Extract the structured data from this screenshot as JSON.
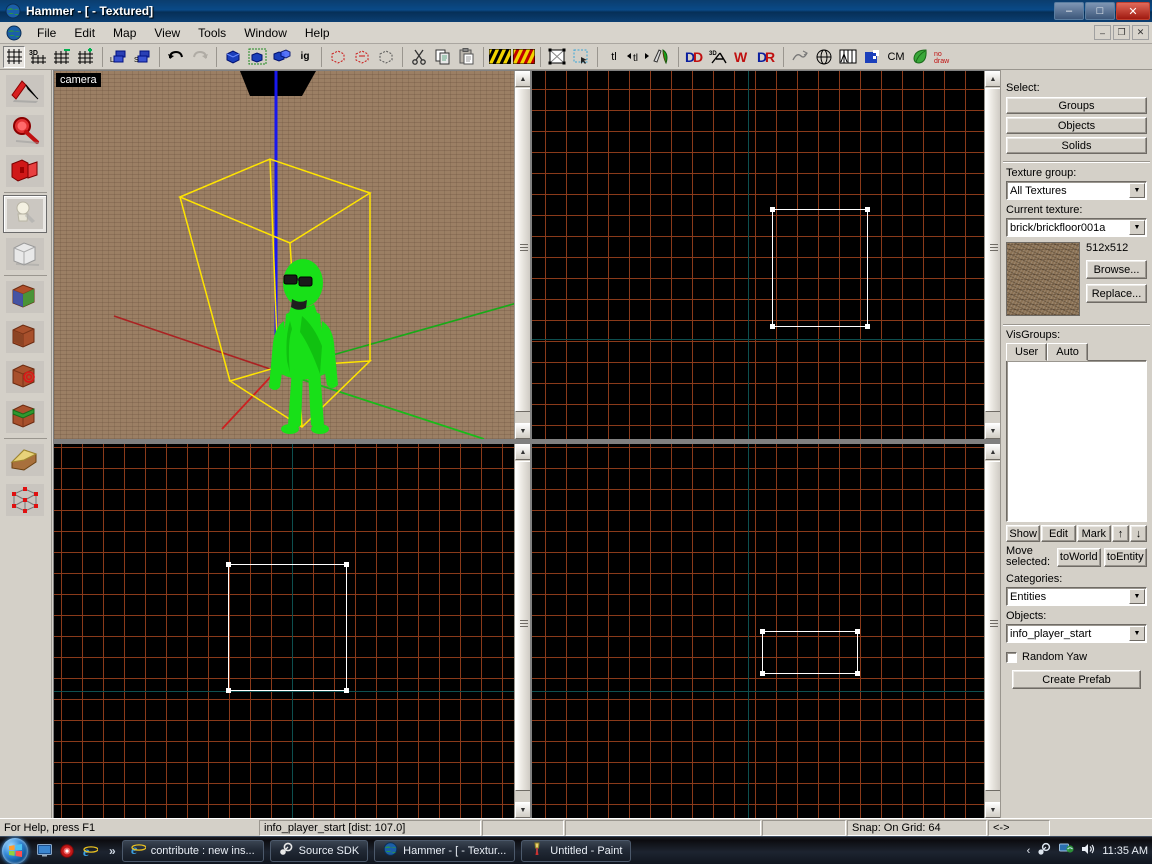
{
  "window": {
    "title": "Hammer - [ - Textured]",
    "icon": "hammer-globe-icon",
    "minimize": "–",
    "maximize": "□",
    "close": "✕"
  },
  "mdi": {
    "minimize": "–",
    "restore": "❐",
    "close": "✕"
  },
  "menu": {
    "items": [
      {
        "label": "File"
      },
      {
        "label": "Edit"
      },
      {
        "label": "Map"
      },
      {
        "label": "View"
      },
      {
        "label": "Tools"
      },
      {
        "label": "Window"
      },
      {
        "label": "Help"
      }
    ]
  },
  "toolbar": {
    "groups": [
      {
        "buttons": [
          {
            "name": "toggle-2d-grid",
            "glyph": "grid",
            "pressed": true
          },
          {
            "name": "toggle-3d-grid",
            "glyph": "grid3d",
            "pressed": false
          },
          {
            "name": "grid-smaller",
            "glyph": "grid-minus",
            "pressed": false
          },
          {
            "name": "grid-larger",
            "glyph": "grid-plus",
            "pressed": false
          }
        ]
      },
      {
        "buttons": [
          {
            "name": "load-pointfile",
            "glyph": "group-l",
            "pressed": false
          },
          {
            "name": "save-selection",
            "glyph": "group-s",
            "pressed": false
          }
        ]
      },
      {
        "buttons": [
          {
            "name": "undo",
            "glyph": "undo",
            "pressed": false
          },
          {
            "name": "redo",
            "glyph": "redo",
            "pressed": false
          }
        ]
      },
      {
        "buttons": [
          {
            "name": "carve",
            "glyph": "solid-blue",
            "pressed": false
          },
          {
            "name": "group",
            "glyph": "group-dashed",
            "pressed": false
          },
          {
            "name": "ungroup",
            "glyph": "ungroup",
            "pressed": false
          },
          {
            "name": "ignore-groups",
            "glyph": "ig",
            "pressed": false
          }
        ]
      },
      {
        "buttons": [
          {
            "name": "hide-selected",
            "glyph": "hide-red",
            "pressed": false
          },
          {
            "name": "hide-unselected",
            "glyph": "hide-red2",
            "pressed": false
          },
          {
            "name": "show-all",
            "glyph": "hide-gray",
            "pressed": false
          }
        ]
      },
      {
        "buttons": [
          {
            "name": "cut",
            "glyph": "scissors",
            "pressed": false
          },
          {
            "name": "copy",
            "glyph": "copy",
            "pressed": false
          },
          {
            "name": "paste",
            "glyph": "paste",
            "pressed": false
          }
        ]
      },
      {
        "buttons": [
          {
            "name": "toggle-cordon",
            "glyph": "hazard-yellow",
            "pressed": false
          },
          {
            "name": "edit-cordon",
            "glyph": "hazard-red",
            "pressed": false
          }
        ]
      },
      {
        "buttons": [
          {
            "name": "toggle-selection-box",
            "glyph": "selbox",
            "pressed": false
          },
          {
            "name": "toggle-auto-select",
            "glyph": "selbox-dashed",
            "pressed": false
          }
        ]
      },
      {
        "buttons": [
          {
            "name": "texture-lock",
            "glyph": "tl",
            "pressed": false
          },
          {
            "name": "texture-scaling-lock",
            "glyph": "tl-scale",
            "pressed": false
          },
          {
            "name": "toggle-texture-apply",
            "glyph": "texapply",
            "pressed": false
          }
        ]
      },
      {
        "buttons": [
          {
            "name": "show-displacement",
            "glyph": "dd",
            "pressed": false
          },
          {
            "name": "show-model-detail",
            "glyph": "3dangle",
            "pressed": false
          },
          {
            "name": "toggle-world-geometry",
            "glyph": "w-red",
            "pressed": false
          },
          {
            "name": "toggle-radius-culling",
            "glyph": "dr",
            "pressed": false
          }
        ]
      },
      {
        "buttons": [
          {
            "name": "run-map",
            "glyph": "runmap",
            "pressed": false
          },
          {
            "name": "toggle-sphere",
            "glyph": "sphere",
            "pressed": false
          },
          {
            "name": "texture-browser",
            "glyph": "texbrowse",
            "pressed": false
          },
          {
            "name": "toggle-cordon-tool",
            "glyph": "checker",
            "pressed": false
          },
          {
            "name": "center-on-map",
            "glyph": "cm",
            "pressed": false
          },
          {
            "name": "toggle-hint",
            "glyph": "leaf",
            "pressed": false
          },
          {
            "name": "nodraw-texture",
            "glyph": "nodraw",
            "pressed": false
          }
        ]
      }
    ],
    "cm_label": "CM",
    "ig_label": "ig",
    "tl_label": "tl",
    "nodraw_label": "no\ndraw"
  },
  "tools": {
    "items": [
      {
        "name": "selection-tool",
        "label": "Selection Tool",
        "selected": false
      },
      {
        "name": "magnify-tool",
        "label": "Magnify",
        "selected": false
      },
      {
        "name": "camera-tool",
        "label": "Camera",
        "selected": false
      },
      {
        "name": "entity-tool",
        "label": "Entity Tool",
        "selected": true
      },
      {
        "name": "block-tool",
        "label": "Block Tool",
        "selected": false
      },
      {
        "name": "texture-application-tool",
        "label": "Texture Application",
        "selected": false
      },
      {
        "name": "apply-decals-tool",
        "label": "Apply Decals",
        "selected": false
      },
      {
        "name": "apply-overlays-tool",
        "label": "Apply Overlays",
        "selected": false
      },
      {
        "name": "clipping-tool",
        "label": "Clipping Tool",
        "selected": false
      },
      {
        "name": "vertex-tool",
        "label": "Vertex Tool",
        "selected": false
      }
    ]
  },
  "viewports": {
    "camera_label": "camera",
    "view_3d": {
      "name": "3d-textured-viewport",
      "label": "camera"
    },
    "top": {
      "name": "top-2d-viewport"
    },
    "front": {
      "name": "front-2d-viewport"
    },
    "side": {
      "name": "side-2d-viewport"
    }
  },
  "right_panel": {
    "select_label": "Select:",
    "select_buttons": [
      {
        "label": "Groups",
        "name": "select-groups-button"
      },
      {
        "label": "Objects",
        "name": "select-objects-button"
      },
      {
        "label": "Solids",
        "name": "select-solids-button"
      }
    ],
    "texture_group_label": "Texture group:",
    "texture_group_value": "All Textures",
    "current_texture_label": "Current texture:",
    "current_texture_value": "brick/brickfloor001a",
    "texture_size": "512x512",
    "browse_label": "Browse...",
    "replace_label": "Replace...",
    "visgroups_label": "VisGroups:",
    "tabs": [
      {
        "label": "User",
        "active": true
      },
      {
        "label": "Auto",
        "active": false
      }
    ],
    "visgroup_items": [],
    "show_label": "Show",
    "edit_label": "Edit",
    "mark_label": "Mark",
    "up_arrow": "↑",
    "down_arrow": "↓",
    "move_selected_label": "Move\nselected:",
    "move_line1": "Move",
    "move_line2": "selected:",
    "to_world_label": "toWorld",
    "to_entity_label": "toEntity",
    "categories_label": "Categories:",
    "categories_value": "Entities",
    "objects_label": "Objects:",
    "objects_value": "info_player_start",
    "random_yaw_label": "Random Yaw",
    "random_yaw_checked": false,
    "create_prefab_label": "Create Prefab"
  },
  "status_bar": {
    "help": "For Help, press F1",
    "selection": "info_player_start   [dist: 107.0]",
    "cell3": "",
    "cell4": "",
    "cell5": "",
    "snap": "Snap: On Grid: 64",
    "zoom": "<->"
  },
  "taskbar": {
    "start_label": "",
    "quick_launch": [
      {
        "name": "show-desktop-icon",
        "glyph": "desktop"
      },
      {
        "name": "media-player-icon",
        "glyph": "mediaplayer"
      },
      {
        "name": "internet-explorer-icon",
        "glyph": "ie"
      }
    ],
    "chevron": "»",
    "buttons": [
      {
        "label": "contribute : new ins...",
        "icon": "ie-icon",
        "active": false
      },
      {
        "label": "Source SDK",
        "icon": "steam-icon",
        "active": false
      },
      {
        "label": "Hammer - [ - Textur...",
        "icon": "hammer-icon",
        "active": true
      },
      {
        "label": "Untitled - Paint",
        "icon": "paint-icon",
        "active": false
      }
    ],
    "tray": {
      "chevron": "‹",
      "icons": [
        {
          "name": "steam-tray-icon",
          "glyph": "steam"
        },
        {
          "name": "network-tray-icon",
          "glyph": "network"
        },
        {
          "name": "volume-tray-icon",
          "glyph": "volume"
        }
      ],
      "clock": "11:35 AM"
    }
  }
}
